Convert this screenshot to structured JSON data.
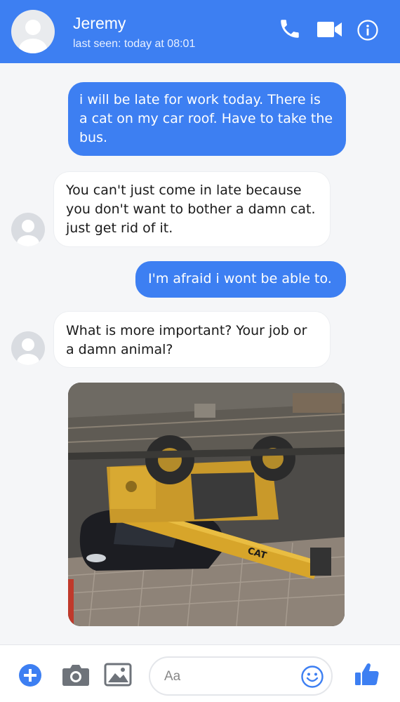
{
  "header": {
    "name": "Jeremy",
    "status": "last seen: today at 08:01",
    "icons": [
      "phone-icon",
      "video-call-icon",
      "info-icon"
    ],
    "color": "#3d7ff2"
  },
  "messages": [
    {
      "direction": "outgoing",
      "lines": [
        "i will be late for work today. There is",
        "a cat on my car roof. Have to take the",
        "bus."
      ]
    },
    {
      "direction": "incoming",
      "lines": [
        "You can't just come in late because",
        "you don't want to bother a damn cat.",
        "just get rid of it."
      ]
    },
    {
      "direction": "outgoing",
      "lines": [
        "I'm afraid i wont be able to."
      ]
    },
    {
      "direction": "incoming",
      "lines": [
        "What is more important? Your job or",
        "a damn animal?"
      ]
    }
  ],
  "photo": {
    "machine_label": "CAT"
  },
  "composer": {
    "placeholder": "Aa",
    "icons": [
      "plus-icon",
      "camera-icon",
      "gallery-icon",
      "emoji-icon",
      "thumbs-up-icon"
    ]
  }
}
